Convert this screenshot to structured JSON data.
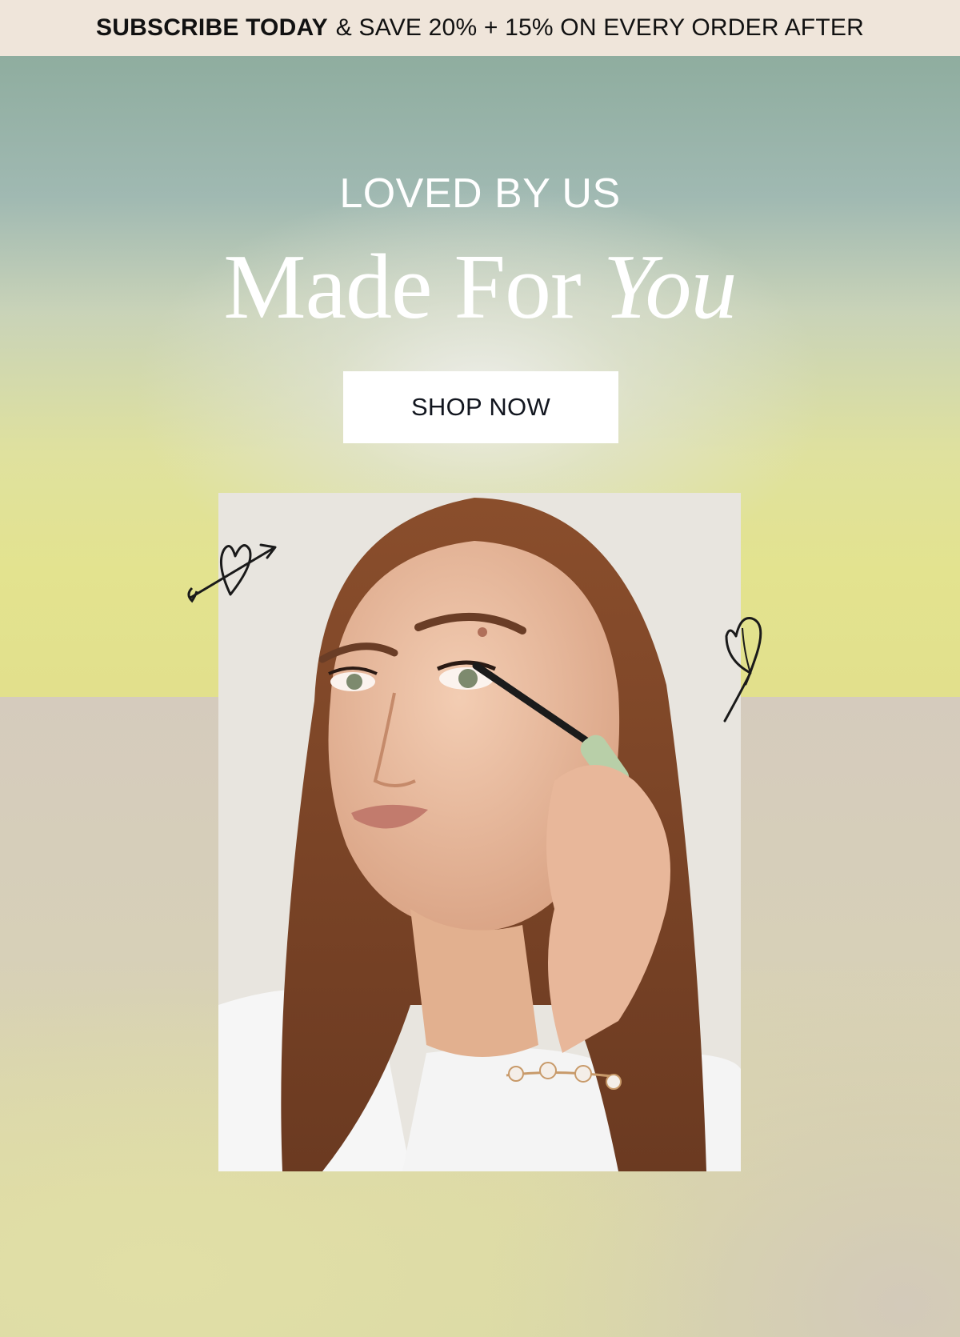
{
  "promo": {
    "strong": "SUBSCRIBE TODAY",
    "rest": "& SAVE  20% + 15% ON EVERY ORDER AFTER"
  },
  "hero": {
    "eyebrow": "LOVED BY US",
    "headline_main": "Made For ",
    "headline_italic": "You",
    "cta_label": "SHOP NOW"
  },
  "colors": {
    "promo_bg": "#efe5da",
    "cta_bg": "#ffffff",
    "cta_text": "#12161f",
    "headline": "#ffffff"
  },
  "icons": {
    "doodle_left": "heart-arrow-icon",
    "doodle_right": "heart-icon"
  }
}
